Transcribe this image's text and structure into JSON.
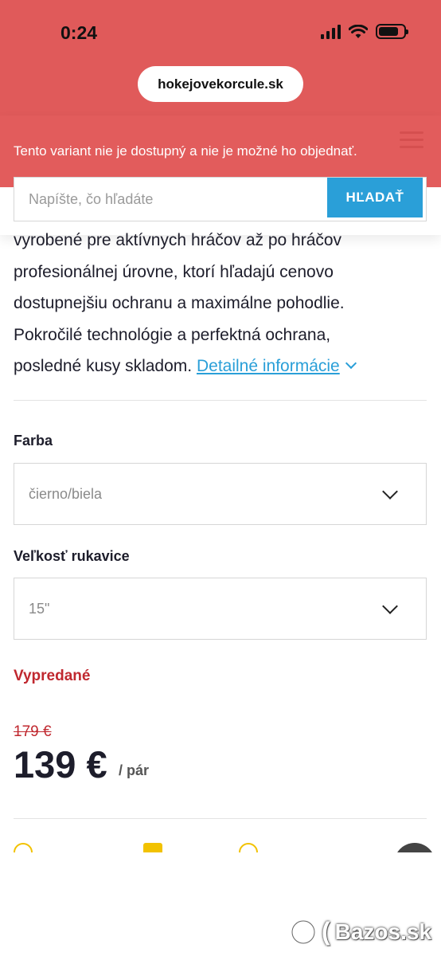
{
  "status_bar": {
    "time": "0:24"
  },
  "browser": {
    "url": "hokejovekorcule.sk"
  },
  "alert": {
    "text": "Tento variant nie je dostupný a nie je možné ho objednať."
  },
  "search": {
    "placeholder": "Napíšte, čo hľadáte",
    "button_label": "HĽADAŤ"
  },
  "product": {
    "description_lines": [
      "vyrobené pre aktívnych hráčov až po hráčov",
      "profesionálnej úrovne, ktorí hľadajú cenovo",
      "dostupnejšiu ochranu a maximálne pohodlie.",
      "Pokročilé technológie a perfektná ochrana,",
      "posledné kusy skladom."
    ],
    "details_link": "Detailné informácie",
    "color_label": "Farba",
    "color_value": "čierno/biela",
    "size_label": "Veľkosť rukavice",
    "size_value": "15\"",
    "availability": "Vypredané",
    "old_price": "179 €",
    "price": "139 €",
    "unit": "/ pár"
  },
  "watermark": {
    "text": "Bazos.sk"
  },
  "colors": {
    "alert_bg": "#e05a5a",
    "accent_blue": "#2a9fd8",
    "soldout_red": "#c0282f"
  }
}
